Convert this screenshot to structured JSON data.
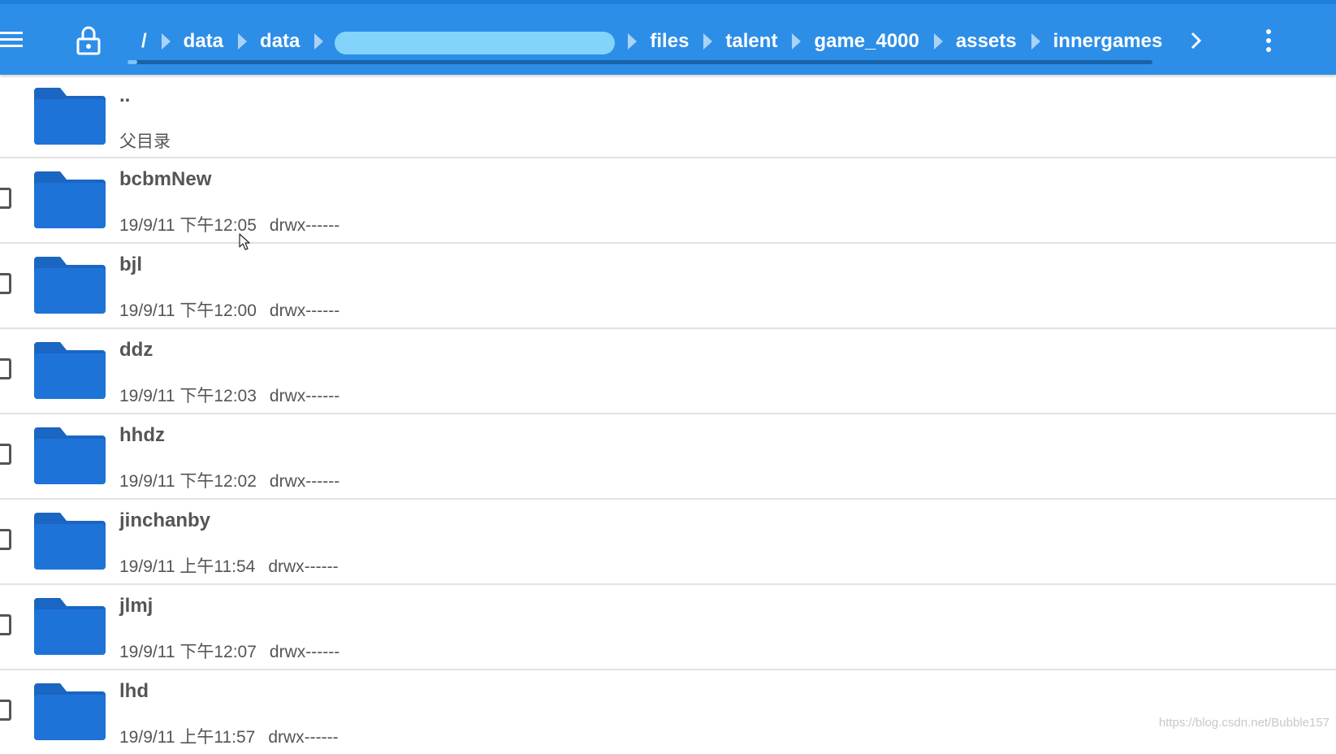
{
  "theme": {
    "toolbar_color": "#2d8ee8",
    "folder_color": "#1e73d8",
    "text_color": "#555555"
  },
  "toolbar": {
    "menu_icon": "hamburger-menu-icon",
    "lock_icon": "lock-open-icon",
    "next_icon": "chevron-right-icon",
    "more_icon": "more-vert-icon",
    "breadcrumbs": [
      "/",
      "data",
      "data",
      "files",
      "talent",
      "game_4000",
      "assets",
      "innergames"
    ]
  },
  "parent_entry": {
    "name": "..",
    "label": "父目录"
  },
  "files": [
    {
      "name": "bcbmNew",
      "date": "19/9/11 下午12:05",
      "perm": "drwx------"
    },
    {
      "name": "bjl",
      "date": "19/9/11 下午12:00",
      "perm": "drwx------"
    },
    {
      "name": "ddz",
      "date": "19/9/11 下午12:03",
      "perm": "drwx------"
    },
    {
      "name": "hhdz",
      "date": "19/9/11 下午12:02",
      "perm": "drwx------"
    },
    {
      "name": "jinchanby",
      "date": "19/9/11 上午11:54",
      "perm": "drwx------"
    },
    {
      "name": "jlmj",
      "date": "19/9/11 下午12:07",
      "perm": "drwx------"
    },
    {
      "name": "lhd",
      "date": "19/9/11 上午11:57",
      "perm": "drwx------"
    }
  ],
  "watermark": "https://blog.csdn.net/Bubble157"
}
